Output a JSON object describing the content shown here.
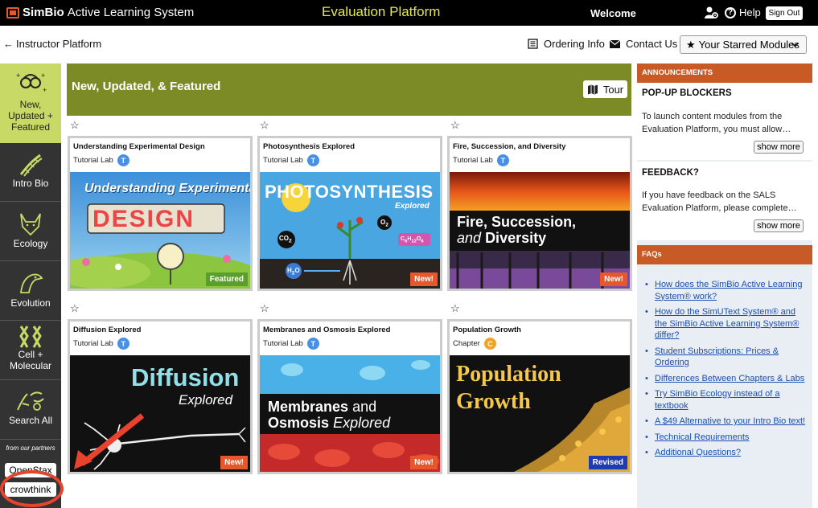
{
  "header": {
    "brand": "SimBio",
    "app_name": "Active Learning System",
    "platform_title": "Evaluation Platform",
    "welcome": "Welcome",
    "help_label": "Help",
    "signout_label": "Sign Out"
  },
  "nav": {
    "back_label": "Instructor Platform",
    "ordering_label": "Ordering Info",
    "contact_label": "Contact Us",
    "starred_label": "Your Starred Modules"
  },
  "sidebar": {
    "items": [
      {
        "label_lines": [
          "New,",
          "Updated +",
          "Featured"
        ],
        "icon": "glasses-sparkle-icon",
        "active": true
      },
      {
        "label": "Intro Bio",
        "icon": "dna-icon"
      },
      {
        "label": "Ecology",
        "icon": "wolf-icon"
      },
      {
        "label": "Evolution",
        "icon": "bird-head-icon"
      },
      {
        "label_lines": [
          "Cell +",
          "Molecular"
        ],
        "icon": "chromosome-icon"
      },
      {
        "label": "Search All",
        "icon": "search-figures-icon"
      }
    ],
    "partners_caption": "from our partners",
    "partners": [
      "OpenStax",
      "crowthink"
    ]
  },
  "banner": {
    "title": "New, Updated, & Featured",
    "tour_label": "Tour"
  },
  "modules": [
    {
      "title": "Understanding Experimental Design",
      "type": "Tutorial Lab",
      "type_letter": "T",
      "badge": "Featured",
      "image_text": [
        "Understanding Experimental",
        "DESIGN"
      ]
    },
    {
      "title": "Photosynthesis Explored",
      "type": "Tutorial Lab",
      "type_letter": "T",
      "badge": "New!",
      "image_text": [
        "PHOTOSYNTHESIS",
        "Explored",
        "CO",
        "2",
        "O",
        "2",
        "C",
        "6",
        "H",
        "12",
        "O",
        "6",
        "H",
        "2",
        "O"
      ]
    },
    {
      "title": "Fire, Succession, and Diversity",
      "type": "Tutorial Lab",
      "type_letter": "T",
      "badge": "New!",
      "image_text": [
        "Fire, Succession,",
        "and",
        "Diversity"
      ]
    },
    {
      "title": "Diffusion Explored",
      "type": "Tutorial Lab",
      "type_letter": "T",
      "badge": "New!",
      "image_text": [
        "Diffusion",
        "Explored"
      ]
    },
    {
      "title": "Membranes and Osmosis Explored",
      "type": "Tutorial Lab",
      "type_letter": "T",
      "badge": "New!",
      "image_text": [
        "Membranes",
        "and",
        "Osmosis",
        "Explored"
      ]
    },
    {
      "title": "Population Growth",
      "type": "Chapter",
      "type_letter": "C",
      "badge": "Revised",
      "image_text": [
        "Population",
        "Growth"
      ]
    }
  ],
  "announcements": {
    "heading": "ANNOUNCEMENTS",
    "items": [
      {
        "title": "POP-UP BLOCKERS",
        "text": "To launch content modules from the Evaluation Platform, you must allow…",
        "more": "show more"
      },
      {
        "title": "FEEDBACK?",
        "text": "If you have feedback on the SALS Evaluation Platform, please complete…",
        "more": "show more"
      }
    ]
  },
  "faqs": {
    "heading": "FAQs",
    "items": [
      "How does the SimBio Active Learning System® work?",
      "How do the SimUText System® and the SimBio Active Learning System® differ?",
      "Student Subscriptions: Prices & Ordering",
      "Differences Between Chapters & Labs",
      "Try SimBio Ecology instead of a textbook",
      "A $49 Alternative to your Intro Bio text!",
      "Technical Requirements",
      "Additional Questions?"
    ]
  },
  "colors": {
    "topbar": "#000000",
    "platform_title": "#e4e84a",
    "banner": "#7d8b27",
    "sidebar": "#333333",
    "sidebar_active": "#c9d965",
    "panel_head": "#c85a26",
    "right_bg": "#e9eef5",
    "badge_new": "#e8572b",
    "badge_featured": "#5a9e2e",
    "badge_revised": "#1f3bb3",
    "type_tutorial": "#4a90e2",
    "type_chapter": "#f0a32a",
    "link": "#1a4fb0",
    "annotation": "#e8432f"
  }
}
